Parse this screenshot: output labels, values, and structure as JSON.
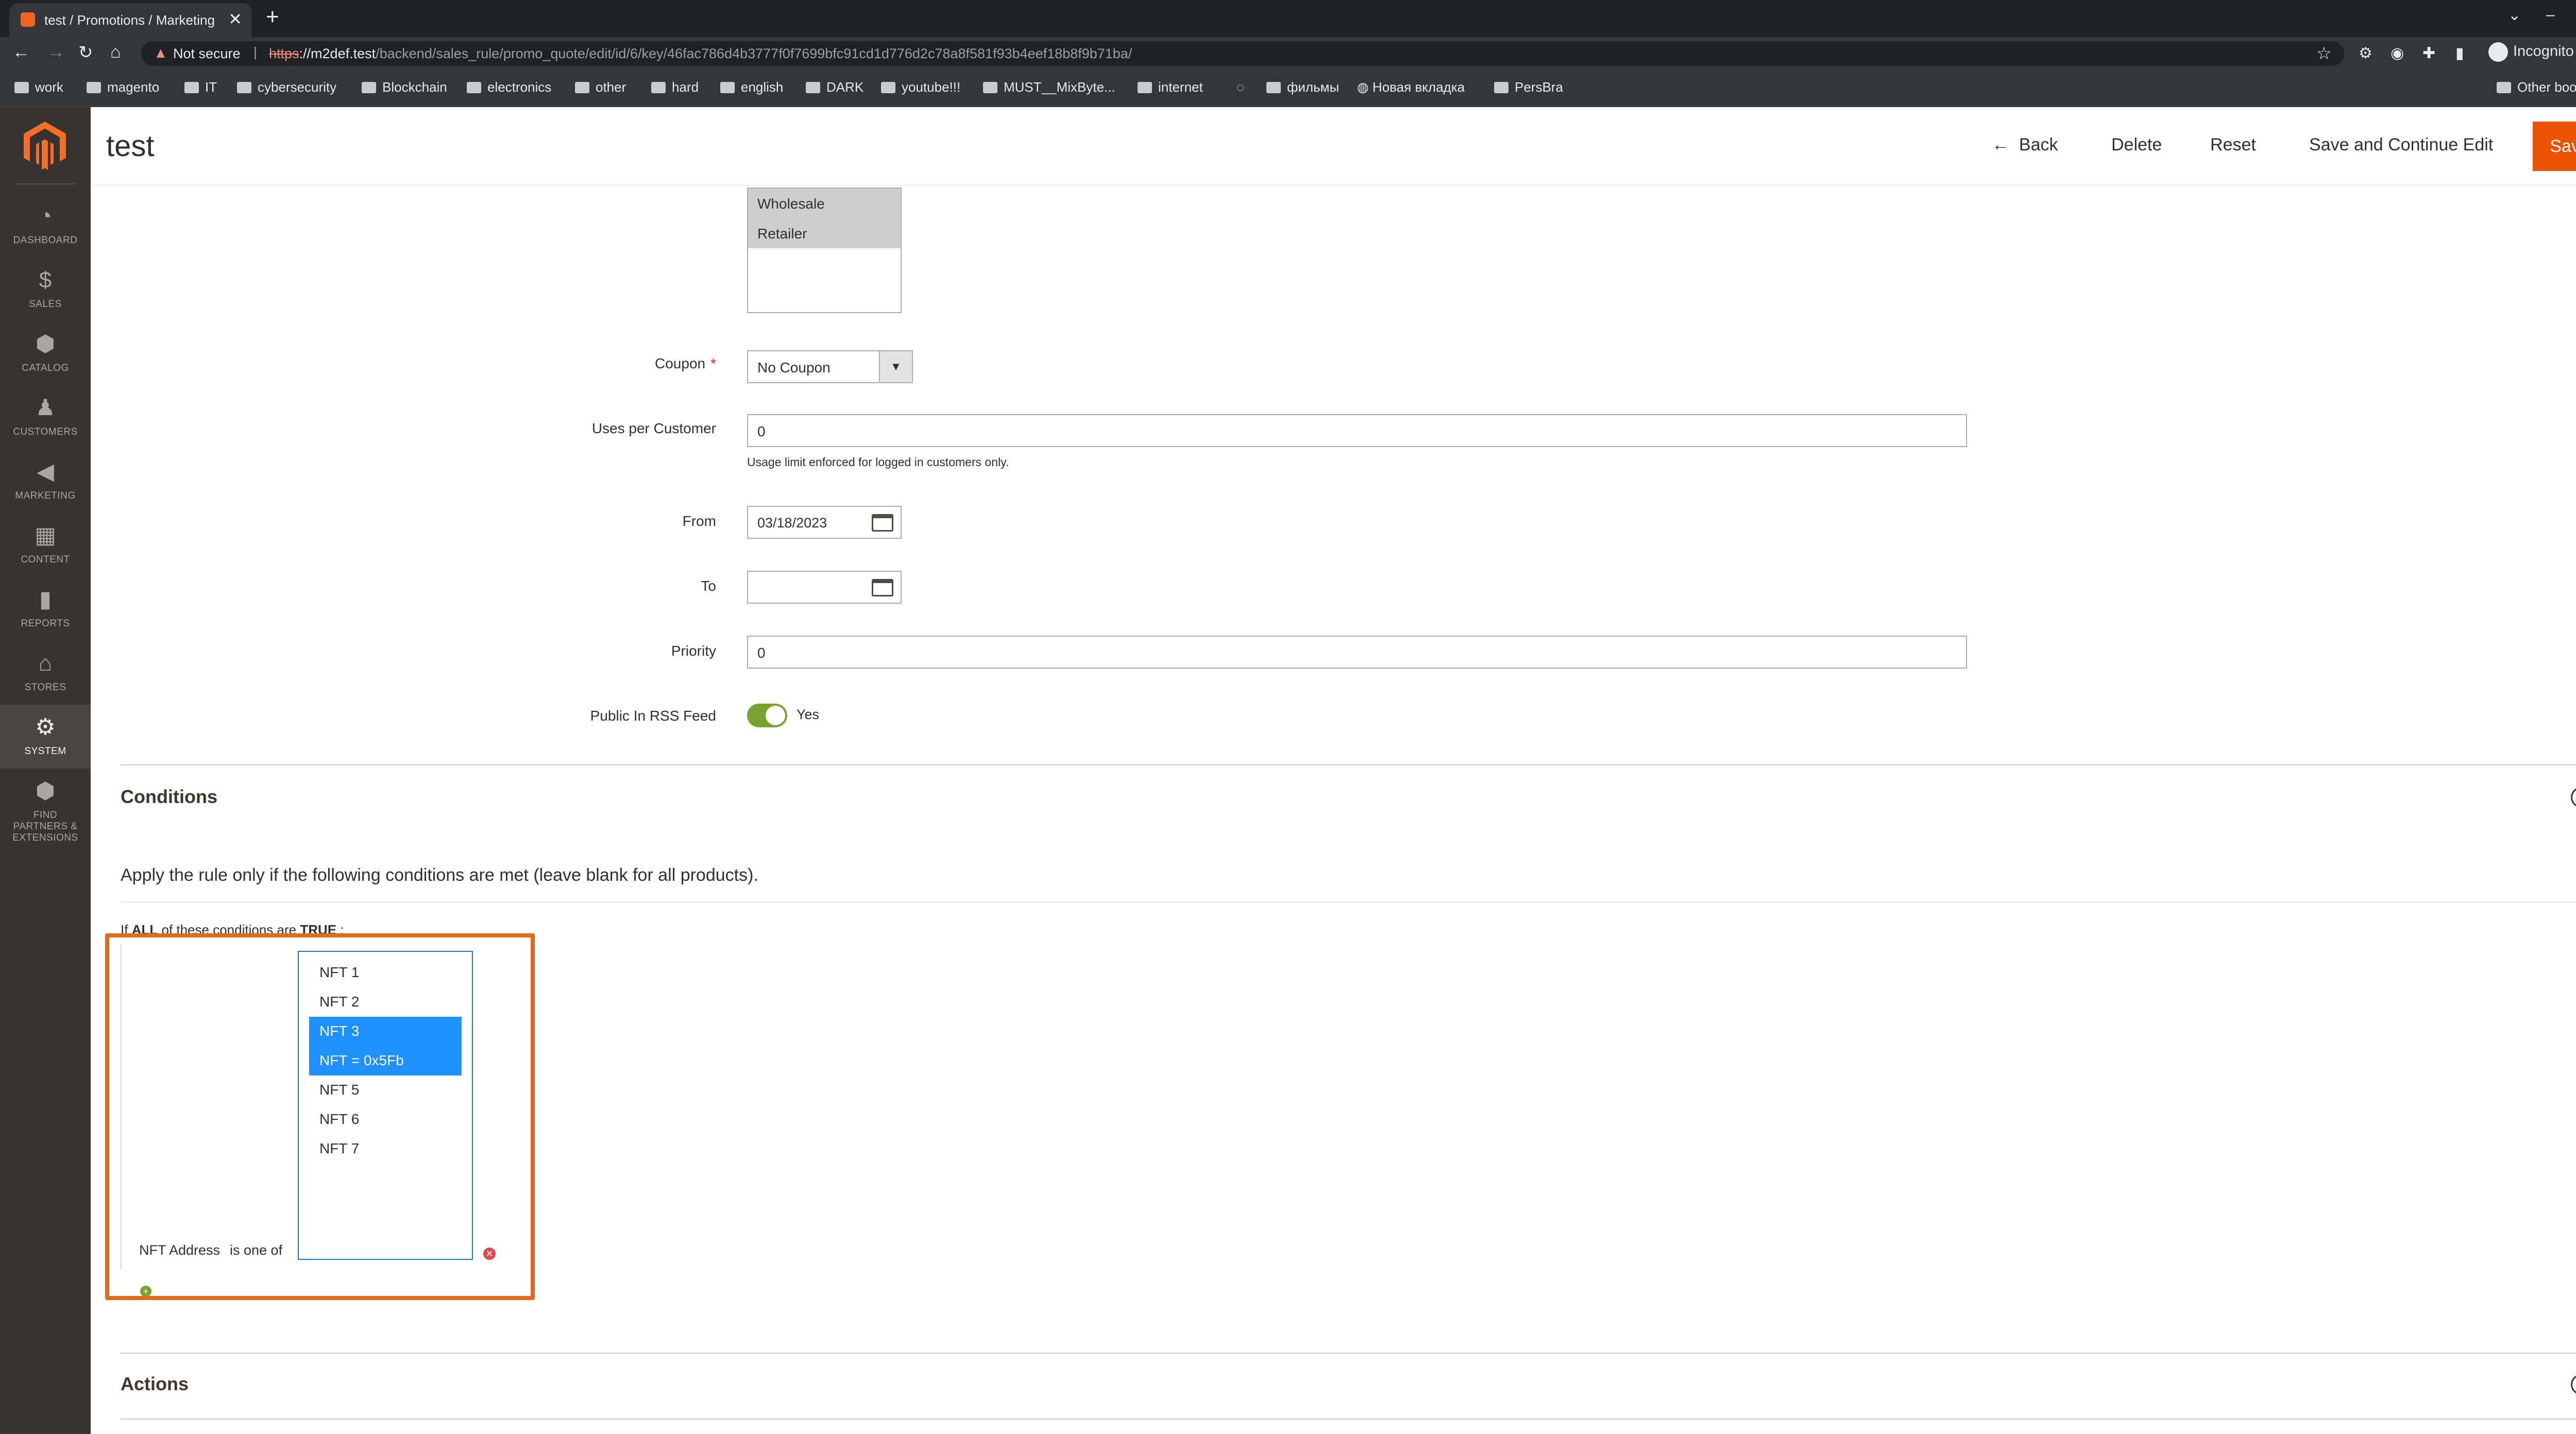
{
  "browser": {
    "tab_title": "test / Promotions / Marketing",
    "tab_close": "✕",
    "new_tab": "+",
    "security_label": "Not secure",
    "url_scheme": "https",
    "url_host": "://m2def.test",
    "url_path": "/backend/sales_rule/promo_quote/edit/id/6/key/46fac786d4b3777f0f7699bfc91cd1d776d2c78a8f581f93b4eef18b8f9b71ba/",
    "profile_label": "Incognito",
    "bookmarks": [
      "work",
      "magento",
      "IT",
      "cybersecurity",
      "Blockchain",
      "electronics",
      "other",
      "hard",
      "english",
      "DARK",
      "youtube!!!",
      "MUST__MixByte...",
      "internet",
      "фильмы",
      "Новая вкладка",
      "PersBra"
    ],
    "other_bookmarks": "Other bookmarks"
  },
  "sidebar": {
    "items": [
      {
        "icon": "dashboard-icon",
        "label": "DASHBOARD",
        "glyph": "◔"
      },
      {
        "icon": "dollar-icon",
        "label": "SALES",
        "glyph": "$"
      },
      {
        "icon": "box-icon",
        "label": "CATALOG",
        "glyph": "⬢"
      },
      {
        "icon": "person-icon",
        "label": "CUSTOMERS",
        "glyph": "♟"
      },
      {
        "icon": "megaphone-icon",
        "label": "MARKETING",
        "glyph": "◀"
      },
      {
        "icon": "content-icon",
        "label": "CONTENT",
        "glyph": "▦"
      },
      {
        "icon": "bar-chart-icon",
        "label": "REPORTS",
        "glyph": "▮"
      },
      {
        "icon": "store-icon",
        "label": "STORES",
        "glyph": "⌂"
      },
      {
        "icon": "gear-icon",
        "label": "SYSTEM",
        "glyph": "⚙"
      },
      {
        "icon": "extensions-icon",
        "label": "FIND PARTNERS & EXTENSIONS",
        "glyph": "⬢"
      }
    ]
  },
  "header": {
    "title": "test",
    "back_label": "Back",
    "delete_label": "Delete",
    "reset_label": "Reset",
    "save_continue_label": "Save and Continue Edit",
    "save_label": "Save"
  },
  "form": {
    "customer_groups": [
      "Wholesale",
      "Retailer"
    ],
    "coupon_label": "Coupon",
    "coupon_value": "No Coupon",
    "uses_per_customer_label": "Uses per Customer",
    "uses_per_customer_value": "0",
    "uses_note": "Usage limit enforced for logged in customers only.",
    "from_label": "From",
    "from_value": "03/18/2023",
    "to_label": "To",
    "to_value": "",
    "priority_label": "Priority",
    "priority_value": "0",
    "rss_label": "Public In RSS Feed",
    "rss_value": "Yes"
  },
  "conditions": {
    "section_title": "Conditions",
    "apply_text": "Apply the rule only if the following conditions are met (leave blank for all products).",
    "if_prefix": "If",
    "if_aggregator": "ALL",
    "if_middle": "of these conditions are",
    "if_value": "TRUE",
    "if_suffix": ":",
    "attribute_label": "NFT Address",
    "operator_label": "is one of",
    "options": [
      "NFT 1",
      "NFT 2",
      "NFT 3",
      "NFT = 0x5Fb",
      "NFT 5",
      "NFT 6",
      "NFT 7"
    ],
    "selected": [
      "NFT 3",
      "NFT = 0x5Fb"
    ]
  },
  "actions": {
    "section_title": "Actions"
  }
}
